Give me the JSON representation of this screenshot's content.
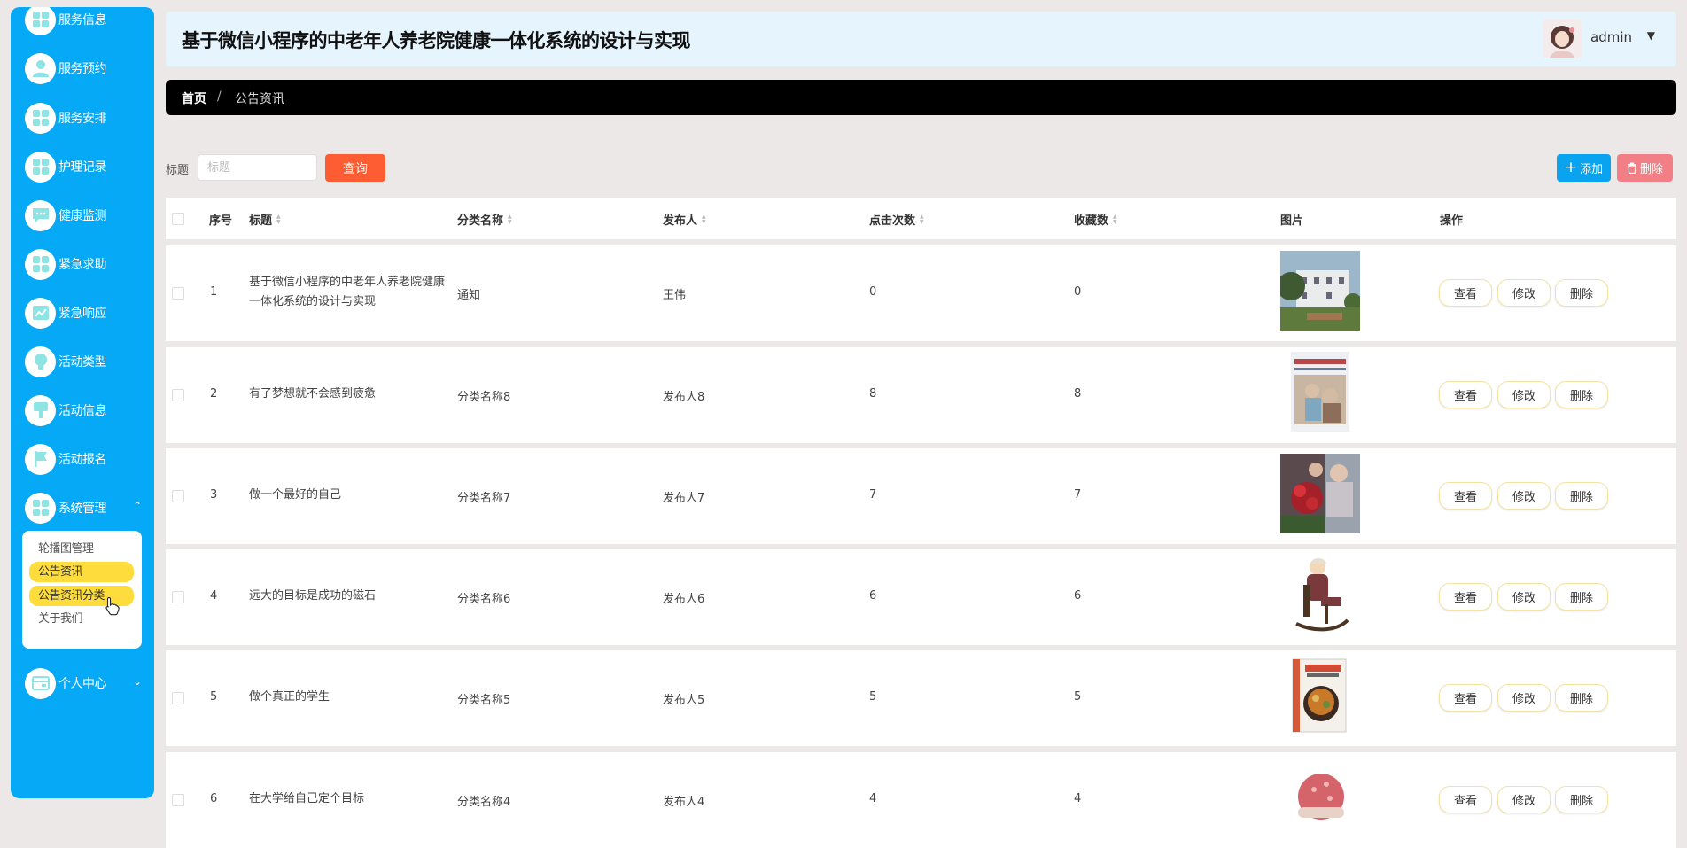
{
  "sidebar": {
    "items": [
      {
        "label": "服务信息",
        "icon": "grid-icon"
      },
      {
        "label": "服务预约",
        "icon": "user-icon"
      },
      {
        "label": "服务安排",
        "icon": "grid-icon"
      },
      {
        "label": "护理记录",
        "icon": "grid-icon"
      },
      {
        "label": "健康监测",
        "icon": "chat-icon"
      },
      {
        "label": "紧急求助",
        "icon": "grid-icon"
      },
      {
        "label": "紧急响应",
        "icon": "trend-icon"
      },
      {
        "label": "活动类型",
        "icon": "bulb-icon"
      },
      {
        "label": "活动信息",
        "icon": "pin-icon"
      },
      {
        "label": "活动报名",
        "icon": "flag-icon"
      },
      {
        "label": "系统管理",
        "icon": "grid-icon"
      },
      {
        "label": "个人中心",
        "icon": "card-icon"
      }
    ],
    "submenu": [
      {
        "label": "轮播图管理"
      },
      {
        "label": "公告资讯"
      },
      {
        "label": "公告资讯分类"
      },
      {
        "label": "关于我们"
      }
    ]
  },
  "header": {
    "title": "基于微信小程序的中老年人养老院健康一体化系统的设计与实现",
    "user": "admin"
  },
  "breadcrumb": {
    "home": "首页",
    "separator": "/",
    "current": "公告资讯"
  },
  "search": {
    "label": "标题",
    "placeholder": "标题",
    "button": "查询"
  },
  "actions": {
    "add": "添加",
    "delete": "删除"
  },
  "table": {
    "headers": {
      "index": "序号",
      "title": "标题",
      "category": "分类名称",
      "publisher": "发布人",
      "clicks": "点击次数",
      "favorites": "收藏数",
      "image": "图片",
      "ops": "操作"
    },
    "op_labels": {
      "view": "查看",
      "edit": "修改",
      "delete": "删除"
    },
    "rows": [
      {
        "index": "1",
        "title": "基于微信小程序的中老年人养老院健康一体化系统的设计与实现",
        "category": "通知",
        "publisher": "王伟",
        "clicks": "0",
        "favorites": "0",
        "image": "building"
      },
      {
        "index": "2",
        "title": "有了梦想就不会感到疲惫",
        "category": "分类名称8",
        "publisher": "发布人8",
        "clicks": "8",
        "favorites": "8",
        "image": "book-cover"
      },
      {
        "index": "3",
        "title": "做一个最好的自己",
        "category": "分类名称7",
        "publisher": "发布人7",
        "clicks": "7",
        "favorites": "7",
        "image": "flowers"
      },
      {
        "index": "4",
        "title": "远大的目标是成功的磁石",
        "category": "分类名称6",
        "publisher": "发布人6",
        "clicks": "6",
        "favorites": "6",
        "image": "rocking-chair"
      },
      {
        "index": "5",
        "title": "做个真正的学生",
        "category": "分类名称5",
        "publisher": "发布人5",
        "clicks": "5",
        "favorites": "5",
        "image": "cookbook"
      },
      {
        "index": "6",
        "title": "在大学给自己定个目标",
        "category": "分类名称4",
        "publisher": "发布人4",
        "clicks": "4",
        "favorites": "4",
        "image": "hat"
      }
    ]
  }
}
